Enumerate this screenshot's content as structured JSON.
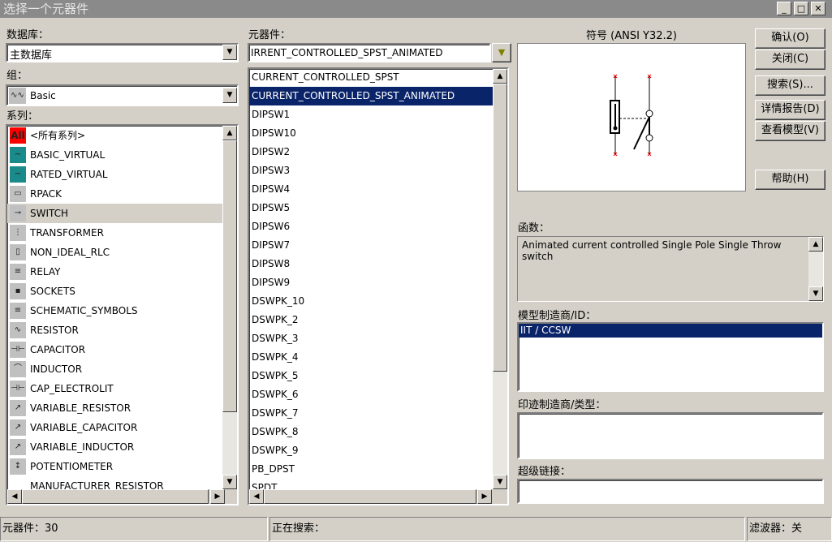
{
  "window": {
    "title": "选择一个元器件",
    "minimize": "_",
    "maximize": "□",
    "close": "✕"
  },
  "left": {
    "database_label": "数据库：",
    "database_value": "主数据库",
    "group_label": "组：",
    "group_value": "Basic",
    "group_icon": "resistor-wave-icon",
    "series_label": "系列：",
    "series": [
      {
        "label": "<所有系列>",
        "icon": "All",
        "selected": false
      },
      {
        "label": "BASIC_VIRTUAL",
        "icon": "~"
      },
      {
        "label": "RATED_VIRTUAL",
        "icon": "~"
      },
      {
        "label": "RPACK",
        "icon": "▭"
      },
      {
        "label": "SWITCH",
        "icon": "⊸",
        "selected": true
      },
      {
        "label": "TRANSFORMER",
        "icon": "⋮"
      },
      {
        "label": "NON_IDEAL_RLC",
        "icon": "▯"
      },
      {
        "label": "RELAY",
        "icon": "≡"
      },
      {
        "label": "SOCKETS",
        "icon": "▪"
      },
      {
        "label": "SCHEMATIC_SYMBOLS",
        "icon": "≡"
      },
      {
        "label": "RESISTOR",
        "icon": "∿"
      },
      {
        "label": "CAPACITOR",
        "icon": "⊣⊢"
      },
      {
        "label": "INDUCTOR",
        "icon": "⌒"
      },
      {
        "label": "CAP_ELECTROLIT",
        "icon": "⊣⊢"
      },
      {
        "label": "VARIABLE_RESISTOR",
        "icon": "↗"
      },
      {
        "label": "VARIABLE_CAPACITOR",
        "icon": "↗"
      },
      {
        "label": "VARIABLE_INDUCTOR",
        "icon": "↗"
      },
      {
        "label": "POTENTIOMETER",
        "icon": "↕"
      },
      {
        "label": "MANUFACTURER_RESISTOR",
        "icon": ""
      }
    ]
  },
  "middle": {
    "component_label": "元器件：",
    "component_value": "IRRENT_CONTROLLED_SPST_ANIMATED",
    "components": [
      "CURRENT_CONTROLLED_SPST",
      "CURRENT_CONTROLLED_SPST_ANIMATED",
      "DIPSW1",
      "DIPSW10",
      "DIPSW2",
      "DIPSW3",
      "DIPSW4",
      "DIPSW5",
      "DIPSW6",
      "DIPSW7",
      "DIPSW8",
      "DIPSW9",
      "DSWPK_10",
      "DSWPK_2",
      "DSWPK_3",
      "DSWPK_4",
      "DSWPK_5",
      "DSWPK_6",
      "DSWPK_7",
      "DSWPK_8",
      "DSWPK_9",
      "PB_DPST",
      "SPDT"
    ],
    "selected_index": 1
  },
  "right": {
    "symbol_label": "符号 (ANSI Y32.2)",
    "buttons": {
      "ok": "确认(O)",
      "close": "关闭(C)",
      "search": "搜索(S)...",
      "report": "详情报告(D)",
      "model": "查看模型(V)",
      "help": "帮助(H)"
    },
    "function_label": "函数：",
    "function_text": "Animated current controlled Single Pole Single Throw switch",
    "model_label": "模型制造商/ID：",
    "model_items": [
      "IIT / CCSW"
    ],
    "footprint_label": "印迹制造商/类型：",
    "hyperlink_label": "超级链接："
  },
  "status": {
    "components": "元器件：30",
    "searching": "正在搜索：",
    "filter": "滤波器：关"
  },
  "colors": {
    "selection": "#0a246a",
    "pin_marker": "#e00000"
  }
}
